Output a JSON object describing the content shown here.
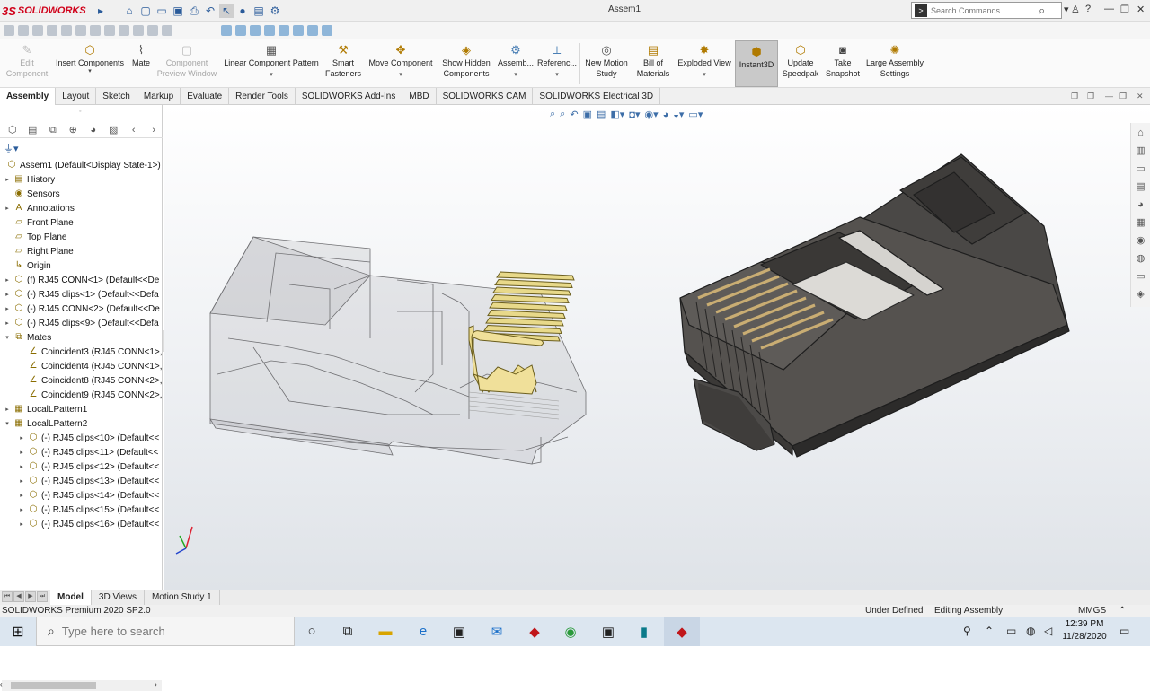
{
  "app": {
    "logo_ds": "3S",
    "logo_text": "SOLIDWORKS",
    "document_title": "Assem1",
    "search_placeholder": "Search Commands"
  },
  "quick_access_icons": [
    "menu-arrow-icon",
    "home-icon",
    "new-document-icon",
    "open-folder-icon",
    "save-icon",
    "print-icon",
    "undo-icon",
    "select-arrow-icon",
    "rebuild-icon",
    "file-properties-icon",
    "options-gear-icon"
  ],
  "window_controls": {
    "search_dropdown": "▾",
    "user": "♙",
    "help": "?",
    "minimize": "—",
    "restore": "❐",
    "close": "✕"
  },
  "ribbon": {
    "edit_component": [
      "Edit",
      "Component"
    ],
    "insert_components": "Insert Components",
    "mate": "Mate",
    "component_preview": [
      "Component",
      "Preview Window"
    ],
    "linear_pattern": "Linear Component Pattern",
    "smart_fasteners": [
      "Smart",
      "Fasteners"
    ],
    "move_component": "Move Component",
    "show_hidden": [
      "Show Hidden",
      "Components"
    ],
    "assembly": "Assemb...",
    "reference": "Referenc...",
    "new_motion_study": [
      "New Motion",
      "Study"
    ],
    "bill_of_materials": [
      "Bill of",
      "Materials"
    ],
    "exploded_view": "Exploded View",
    "instant3d": "Instant3D",
    "update_speedpak": [
      "Update",
      "Speedpak"
    ],
    "take_snapshot": [
      "Take",
      "Snapshot"
    ],
    "large_assembly": [
      "Large Assembly",
      "Settings"
    ]
  },
  "command_tabs": [
    "Assembly",
    "Layout",
    "Sketch",
    "Markup",
    "Evaluate",
    "Render Tools",
    "SOLIDWORKS Add-Ins",
    "MBD",
    "SOLIDWORKS CAM",
    "SOLIDWORKS Electrical 3D"
  ],
  "tree": {
    "root": "Assem1  (Default<Display State-1>)",
    "items": [
      {
        "label": "History",
        "icon": "history-icon",
        "glyph": "▤",
        "arrow": "▸",
        "indent": 0
      },
      {
        "label": "Sensors",
        "icon": "sensors-icon",
        "glyph": "◉",
        "arrow": "",
        "indent": 0
      },
      {
        "label": "Annotations",
        "icon": "annotations-icon",
        "glyph": "A",
        "arrow": "▸",
        "indent": 0
      },
      {
        "label": "Front Plane",
        "icon": "plane-icon",
        "glyph": "▱",
        "arrow": "",
        "indent": 0
      },
      {
        "label": "Top Plane",
        "icon": "plane-icon",
        "glyph": "▱",
        "arrow": "",
        "indent": 0
      },
      {
        "label": "Right Plane",
        "icon": "plane-icon",
        "glyph": "▱",
        "arrow": "",
        "indent": 0
      },
      {
        "label": "Origin",
        "icon": "origin-icon",
        "glyph": "↳",
        "arrow": "",
        "indent": 0
      },
      {
        "label": "(f) RJ45 CONN<1> (Default<<De",
        "icon": "part-icon",
        "glyph": "⬡",
        "arrow": "▸",
        "indent": 0
      },
      {
        "label": "(-) RJ45 clips<1> (Default<<Defa",
        "icon": "part-icon",
        "glyph": "⬡",
        "arrow": "▸",
        "indent": 0
      },
      {
        "label": "(-) RJ45 CONN<2> (Default<<De",
        "icon": "part-icon",
        "glyph": "⬡",
        "arrow": "▸",
        "indent": 0
      },
      {
        "label": "(-) RJ45 clips<9> (Default<<Defa",
        "icon": "part-icon",
        "glyph": "⬡",
        "arrow": "▸",
        "indent": 0
      },
      {
        "label": "Mates",
        "icon": "mates-icon",
        "glyph": "⧉",
        "arrow": "▾",
        "indent": 0
      },
      {
        "label": "Coincident3 (RJ45 CONN<1>,I",
        "icon": "coincident-mate-icon",
        "glyph": "∠",
        "arrow": "",
        "indent": 1
      },
      {
        "label": "Coincident4 (RJ45 CONN<1>,I",
        "icon": "coincident-mate-icon",
        "glyph": "∠",
        "arrow": "",
        "indent": 1
      },
      {
        "label": "Coincident8 (RJ45 CONN<2>,I",
        "icon": "coincident-mate-icon",
        "glyph": "∠",
        "arrow": "",
        "indent": 1
      },
      {
        "label": "Coincident9 (RJ45 CONN<2>,I",
        "icon": "coincident-mate-icon",
        "glyph": "∠",
        "arrow": "",
        "indent": 1
      },
      {
        "label": "LocalLPattern1",
        "icon": "pattern-icon",
        "glyph": "▦",
        "arrow": "▸",
        "indent": 0
      },
      {
        "label": "LocalLPattern2",
        "icon": "pattern-icon",
        "glyph": "▦",
        "arrow": "▾",
        "indent": 0
      },
      {
        "label": "(-) RJ45 clips<10> (Default<<",
        "icon": "part-icon",
        "glyph": "⬡",
        "arrow": "▸",
        "indent": 1
      },
      {
        "label": "(-) RJ45 clips<11> (Default<<",
        "icon": "part-icon",
        "glyph": "⬡",
        "arrow": "▸",
        "indent": 1
      },
      {
        "label": "(-) RJ45 clips<12> (Default<<",
        "icon": "part-icon",
        "glyph": "⬡",
        "arrow": "▸",
        "indent": 1
      },
      {
        "label": "(-) RJ45 clips<13> (Default<<",
        "icon": "part-icon",
        "glyph": "⬡",
        "arrow": "▸",
        "indent": 1
      },
      {
        "label": "(-) RJ45 clips<14> (Default<<",
        "icon": "part-icon",
        "glyph": "⬡",
        "arrow": "▸",
        "indent": 1
      },
      {
        "label": "(-) RJ45 clips<15> (Default<<",
        "icon": "part-icon",
        "glyph": "⬡",
        "arrow": "▸",
        "indent": 1
      },
      {
        "label": "(-) RJ45 clips<16> (Default<<",
        "icon": "part-icon",
        "glyph": "⬡",
        "arrow": "▸",
        "indent": 1
      }
    ]
  },
  "bottom_tabs": [
    "Model",
    "3D Views",
    "Motion Study 1"
  ],
  "status": {
    "product": "SOLIDWORKS Premium 2020 SP2.0",
    "definition": "Under Defined",
    "mode": "Editing Assembly",
    "units": "MMGS"
  },
  "taskbar": {
    "search_placeholder": "Type here to search",
    "time": "12:39 PM",
    "date": "11/28/2020"
  },
  "colors": {
    "brand_red": "#d0021b",
    "clip_gold": "#e8d98a",
    "connector_dark": "#4a4846",
    "selection_blue": "#2a5b9a"
  }
}
